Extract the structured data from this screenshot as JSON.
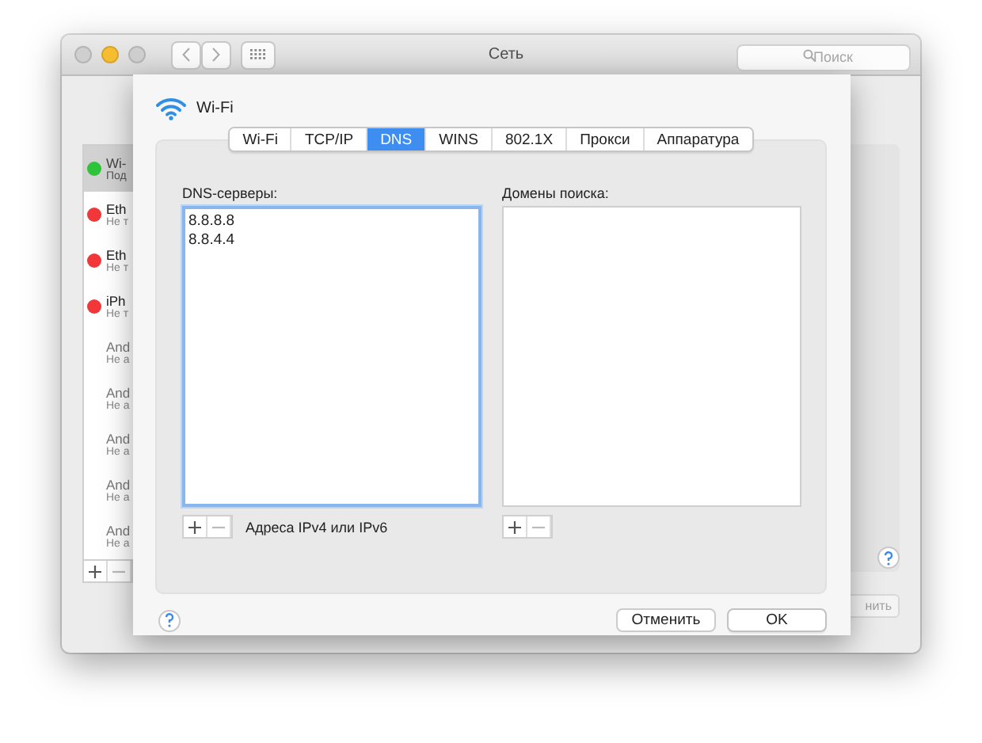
{
  "window": {
    "title": "Сеть",
    "search_placeholder": "Поиск"
  },
  "sidebar": {
    "items": [
      {
        "name": "Wi-",
        "status": "Под",
        "color": "#2ec43a",
        "selected": true,
        "dimmed": false
      },
      {
        "name": "Eth",
        "status": "Не т",
        "color": "#f2373a",
        "selected": false,
        "dimmed": false
      },
      {
        "name": "Eth",
        "status": "Не т",
        "color": "#f2373a",
        "selected": false,
        "dimmed": false
      },
      {
        "name": "iPh",
        "status": "Не т",
        "color": "#f2373a",
        "selected": false,
        "dimmed": false
      },
      {
        "name": "And",
        "status": "Не а",
        "selected": false,
        "dimmed": true
      },
      {
        "name": "And",
        "status": "Не а",
        "selected": false,
        "dimmed": true
      },
      {
        "name": "And",
        "status": "Не а",
        "selected": false,
        "dimmed": true
      },
      {
        "name": "And",
        "status": "Не а",
        "selected": false,
        "dimmed": true
      },
      {
        "name": "And",
        "status": "Не а",
        "selected": false,
        "dimmed": true
      }
    ]
  },
  "background_button": "нить",
  "sheet": {
    "title": "Wi-Fi",
    "tabs": [
      {
        "label": "Wi-Fi",
        "selected": false
      },
      {
        "label": "TCP/IP",
        "selected": false
      },
      {
        "label": "DNS",
        "selected": true
      },
      {
        "label": "WINS",
        "selected": false
      },
      {
        "label": "802.1X",
        "selected": false
      },
      {
        "label": "Прокси",
        "selected": false
      },
      {
        "label": "Аппаратура",
        "selected": false
      }
    ],
    "dns_servers": {
      "label": "DNS-серверы:",
      "entries": [
        "8.8.8.8",
        "8.8.4.4"
      ],
      "focused": true,
      "hint": "Адреса IPv4 или IPv6"
    },
    "search_domains": {
      "label": "Домены поиска:",
      "focused": false
    },
    "buttons": [
      {
        "label": "Отменить",
        "kind": "cancel"
      },
      {
        "label": "OK",
        "kind": "ok"
      }
    ]
  }
}
